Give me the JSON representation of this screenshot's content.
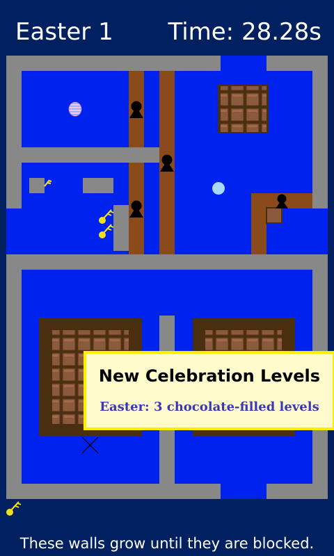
{
  "header": {
    "level_name": "Easter 1",
    "timer": "Time: 28.28s"
  },
  "banner": {
    "title": "New Celebration Levels",
    "subtitle": "Easter: 3 chocolate-filled levels"
  },
  "footer": {
    "hint": "These walls grow until they are blocked."
  },
  "colors": {
    "background": "#002060",
    "water": "#0022ee",
    "wall": "#888888",
    "wooden_wall": "#8b4a1a",
    "chocolate": "#8b5a3c",
    "chocolate_tray": "#4a2e10",
    "key": "#f0e020",
    "ball": "#a8d8ff",
    "banner_bg": "#fffbcc",
    "banner_border": "#ffee00"
  },
  "icons": [
    "keyhole-icon",
    "key-icon",
    "easter-egg-icon",
    "ball-icon",
    "x-mark-icon"
  ]
}
